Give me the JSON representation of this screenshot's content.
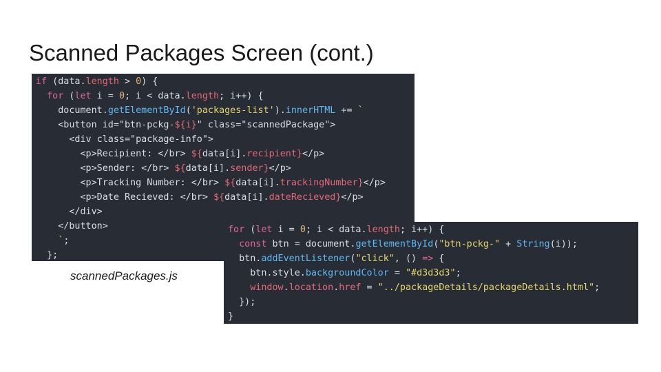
{
  "slide": {
    "title": "Scanned Packages Screen (cont.)",
    "caption": "scannedPackages.js"
  },
  "colors": {
    "code_background": "#272c35",
    "keyword": "#e0659e",
    "function": "#5fb8f2",
    "string": "#e3d66c",
    "number": "#e4b37e",
    "property": "#e46876",
    "plain": "#d8dde6"
  },
  "snippet1": [
    [
      [
        "if",
        "kw"
      ],
      [
        " (data.",
        ""
      ],
      [
        "length",
        "prop"
      ],
      [
        " > ",
        ""
      ],
      [
        "0",
        "num"
      ],
      [
        ") {",
        ""
      ]
    ],
    [
      [
        "  ",
        ""
      ],
      [
        "for",
        "kw"
      ],
      [
        " (",
        ""
      ],
      [
        "let",
        "kw"
      ],
      [
        " i = ",
        ""
      ],
      [
        "0",
        "num"
      ],
      [
        "; i < data.",
        ""
      ],
      [
        "length",
        "prop"
      ],
      [
        "; i++) {",
        ""
      ]
    ],
    [
      [
        "    document.",
        ""
      ],
      [
        "getElementById",
        "fn"
      ],
      [
        "(",
        ""
      ],
      [
        "'packages-list'",
        "str"
      ],
      [
        ").",
        ""
      ],
      [
        "innerHTML",
        "fn"
      ],
      [
        " += ",
        ""
      ],
      [
        "`",
        "str"
      ]
    ],
    [
      [
        "    <button id=\"btn-pckg-",
        ""
      ],
      [
        "${i}",
        "prop"
      ],
      [
        "\" class=\"scannedPackage\">",
        ""
      ]
    ],
    [
      [
        "      <div class=\"package-info\">",
        ""
      ]
    ],
    [
      [
        "        <p>Recipient: </br> ",
        ""
      ],
      [
        "${",
        "prop"
      ],
      [
        "data[i].",
        ""
      ],
      [
        "recipient",
        "prop"
      ],
      [
        "}",
        "prop"
      ],
      [
        "</p>",
        ""
      ]
    ],
    [
      [
        "        <p>Sender: </br> ",
        ""
      ],
      [
        "${",
        "prop"
      ],
      [
        "data[i].",
        ""
      ],
      [
        "sender",
        "prop"
      ],
      [
        "}",
        "prop"
      ],
      [
        "</p>",
        ""
      ]
    ],
    [
      [
        "        <p>Tracking Number: </br> ",
        ""
      ],
      [
        "${",
        "prop"
      ],
      [
        "data[i].",
        ""
      ],
      [
        "trackingNumber",
        "prop"
      ],
      [
        "}",
        "prop"
      ],
      [
        "</p>",
        ""
      ]
    ],
    [
      [
        "        <p>Date Recieved: </br> ",
        ""
      ],
      [
        "${",
        "prop"
      ],
      [
        "data[i].",
        ""
      ],
      [
        "dateRecieved",
        "prop"
      ],
      [
        "}",
        "prop"
      ],
      [
        "</p>",
        ""
      ]
    ],
    [
      [
        "      </div>",
        ""
      ]
    ],
    [
      [
        "    </button>",
        ""
      ]
    ],
    [
      [
        "    `",
        "str"
      ],
      [
        ";",
        ""
      ]
    ],
    [
      [
        "  };",
        ""
      ]
    ]
  ],
  "snippet2": [
    [
      [
        "for",
        "kw"
      ],
      [
        " (",
        ""
      ],
      [
        "let",
        "kw"
      ],
      [
        " i = ",
        ""
      ],
      [
        "0",
        "num"
      ],
      [
        "; i < data.",
        ""
      ],
      [
        "length",
        "prop"
      ],
      [
        "; i++) {",
        ""
      ]
    ],
    [
      [
        "  ",
        ""
      ],
      [
        "const",
        "kw"
      ],
      [
        " btn = document.",
        ""
      ],
      [
        "getElementById",
        "fn"
      ],
      [
        "(",
        ""
      ],
      [
        "\"btn-pckg-\"",
        "str"
      ],
      [
        " + ",
        ""
      ],
      [
        "String",
        "fn"
      ],
      [
        "(i));",
        ""
      ]
    ],
    [
      [
        "  btn.",
        ""
      ],
      [
        "addEventListener",
        "fn"
      ],
      [
        "(",
        ""
      ],
      [
        "\"click\"",
        "str"
      ],
      [
        ", () ",
        ""
      ],
      [
        "=>",
        "kw"
      ],
      [
        " {",
        ""
      ]
    ],
    [
      [
        "    btn.style.",
        ""
      ],
      [
        "backgroundColor",
        "fn"
      ],
      [
        " = ",
        ""
      ],
      [
        "\"#d3d3d3\"",
        "str"
      ],
      [
        ";",
        ""
      ]
    ],
    [
      [
        "    ",
        ""
      ],
      [
        "window",
        "prop"
      ],
      [
        ".",
        ""
      ],
      [
        "location",
        "prop"
      ],
      [
        ".",
        ""
      ],
      [
        "href",
        "prop"
      ],
      [
        " = ",
        ""
      ],
      [
        "\"../packageDetails/packageDetails.html\"",
        "str"
      ],
      [
        ";",
        ""
      ]
    ],
    [
      [
        "  });",
        ""
      ]
    ],
    [
      [
        "}",
        ""
      ]
    ]
  ]
}
